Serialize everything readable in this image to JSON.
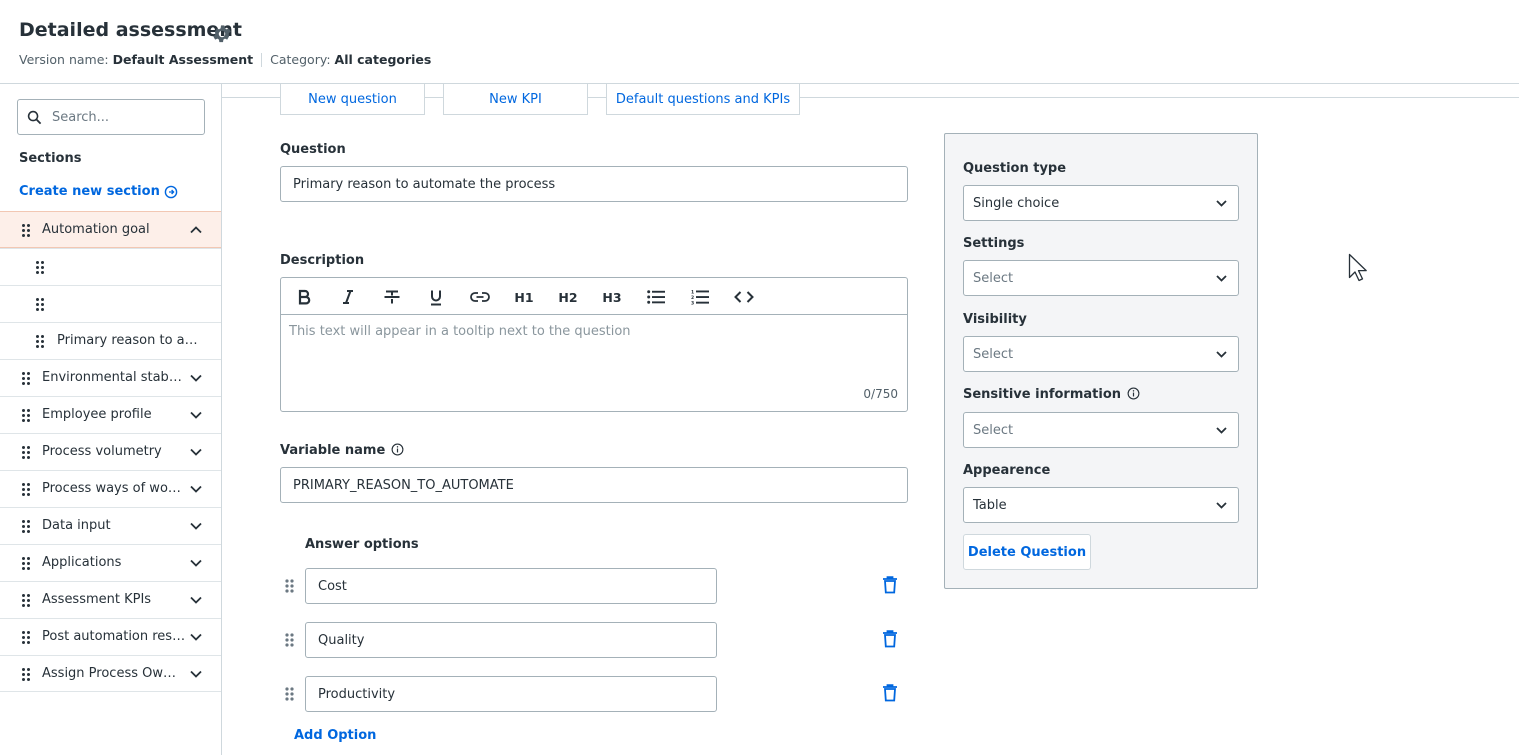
{
  "header": {
    "title": "Detailed assessment",
    "version_label": "Version name:",
    "version_value": "Default Assessment",
    "category_label": "Category:",
    "category_value": "All categories"
  },
  "sidebar": {
    "search_placeholder": "Search...",
    "sections_title": "Sections",
    "create_section": "Create new section",
    "items": [
      {
        "label": "Automation goal",
        "level": 0,
        "expanded": true,
        "active": true
      },
      {
        "label": "",
        "level": 1
      },
      {
        "label": "",
        "level": 1
      },
      {
        "label": "Primary reason to auto...",
        "level": 1
      },
      {
        "label": "Environmental stability",
        "level": 0
      },
      {
        "label": "Employee profile",
        "level": 0
      },
      {
        "label": "Process volumetry",
        "level": 0
      },
      {
        "label": "Process ways of worki...",
        "level": 0
      },
      {
        "label": "Data input",
        "level": 0
      },
      {
        "label": "Applications",
        "level": 0
      },
      {
        "label": "Assessment KPIs",
        "level": 0
      },
      {
        "label": "Post automation results",
        "level": 0
      },
      {
        "label": "Assign Process Owner",
        "level": 0
      }
    ]
  },
  "tabs": [
    "New question",
    "New KPI",
    "Default questions and KPIs"
  ],
  "form": {
    "question_label": "Question",
    "question_value": "Primary reason to automate the process",
    "description_label": "Description",
    "description_placeholder": "This text will appear in a tooltip next to the question",
    "description_count": "0/750",
    "toolbar": [
      "B",
      "I",
      "S",
      "U",
      "link",
      "H1",
      "H2",
      "H3",
      "bulleted-list",
      "numbered-list",
      "code"
    ],
    "variable_label": "Variable name",
    "variable_value": "PRIMARY_REASON_TO_AUTOMATE",
    "answer_options_label": "Answer options",
    "answer_options": [
      "Cost",
      "Quality",
      "Productivity"
    ],
    "add_option": "Add Option"
  },
  "panel": {
    "question_type_label": "Question type",
    "question_type_value": "Single choice",
    "settings_label": "Settings",
    "settings_value": "Select",
    "visibility_label": "Visibility",
    "visibility_value": "Select",
    "sensitive_label": "Sensitive information",
    "sensitive_value": "Select",
    "appearance_label": "Appearence",
    "appearance_value": "Table",
    "delete_button": "Delete Question"
  },
  "colors": {
    "accent": "#0067df",
    "active_row": "#fdefe9",
    "panel_bg": "#f4f5f7"
  }
}
